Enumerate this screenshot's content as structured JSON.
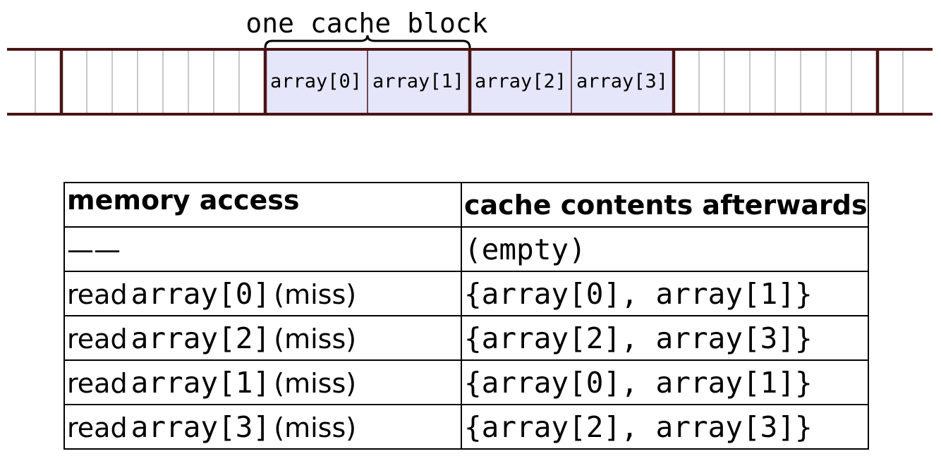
{
  "diagram": {
    "block_label": "one cache block",
    "cells": [
      "array[0]",
      "array[1]",
      "array[2]",
      "array[3]"
    ],
    "colors": {
      "line": "#4a1414",
      "cell_fill": "#e6e6fa",
      "thin_line": "#b5b5b5"
    }
  },
  "table": {
    "headers": [
      "memory access",
      "cache contents afterwards"
    ],
    "rows": [
      {
        "access": {
          "verb": "",
          "target": "",
          "result": "——"
        },
        "cache": "(empty)"
      },
      {
        "access": {
          "verb": "read",
          "target": "array[0]",
          "result": "(miss)"
        },
        "cache": "{array[0], array[1]}"
      },
      {
        "access": {
          "verb": "read",
          "target": "array[2]",
          "result": "(miss)"
        },
        "cache": "{array[2], array[3]}"
      },
      {
        "access": {
          "verb": "read",
          "target": "array[1]",
          "result": "(miss)"
        },
        "cache": "{array[0], array[1]}"
      },
      {
        "access": {
          "verb": "read",
          "target": "array[3]",
          "result": "(miss)"
        },
        "cache": "{array[2], array[3]}"
      }
    ]
  }
}
